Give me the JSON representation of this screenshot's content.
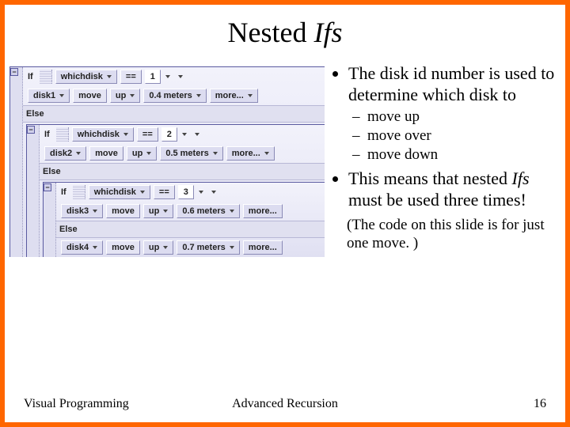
{
  "title_a": "Nested ",
  "title_b": "Ifs",
  "code": {
    "if": "If",
    "else": "Else",
    "eqeq": "==",
    "move": "move",
    "up": "up",
    "meters": "meters",
    "more": "more...",
    "whichdisk": "whichdisk",
    "lv1": {
      "num": "1",
      "disk": "disk1",
      "amt": "0.4"
    },
    "lv2": {
      "num": "2",
      "disk": "disk2",
      "amt": "0.5"
    },
    "lv3": {
      "num": "3",
      "disk": "disk3",
      "amt": "0.6"
    },
    "lv4": {
      "disk": "disk4",
      "amt": "0.7"
    }
  },
  "notes": {
    "b1": "The disk id number is used to determine which disk to",
    "s1": "move up",
    "s2": "move over",
    "s3": "move down",
    "b2a": "This means that nested ",
    "b2b": "Ifs",
    "b2c": " must be used three times!",
    "paren": "(The code on this slide is for just one move. )"
  },
  "footer": {
    "left": "Visual Programming",
    "center": "Advanced Recursion",
    "right": "16"
  }
}
